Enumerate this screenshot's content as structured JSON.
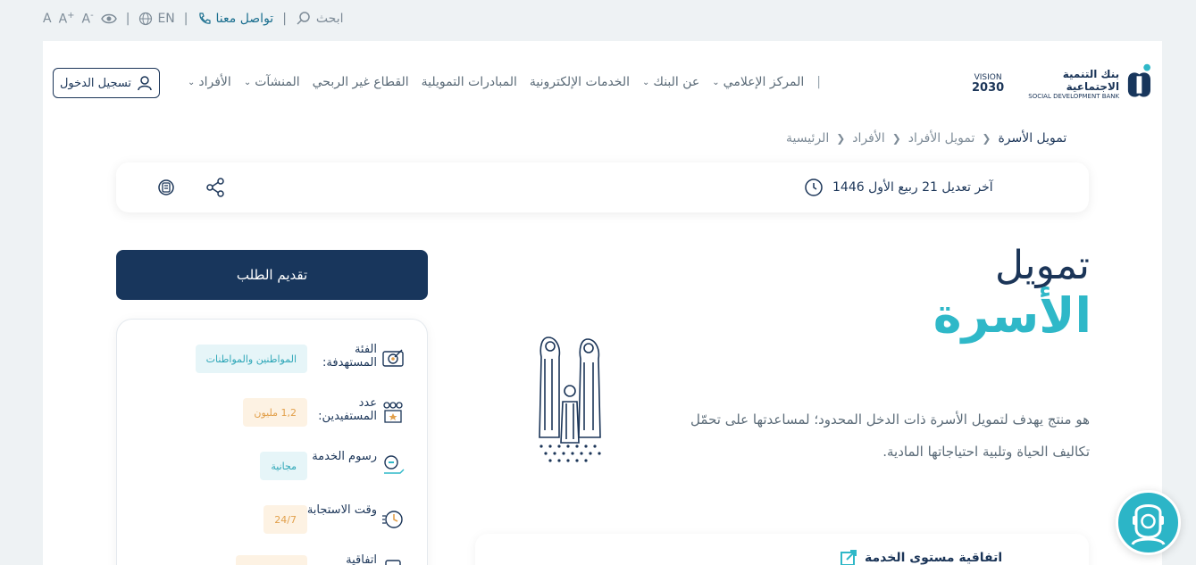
{
  "topbar": {
    "search": "ابحث",
    "contact": "تواصل معنا",
    "lang": "EN",
    "font_small": "A",
    "font_large": "A",
    "font_reset": "A",
    "minus": "-",
    "plus": "+",
    "sep": "|"
  },
  "logo": {
    "arabic": "بنك التنمية الاجتماعية",
    "english": "SOCIAL DEVELOPMENT BANK",
    "vision_label": "VISION",
    "vision_year": "2030"
  },
  "nav": {
    "items": [
      {
        "label": "الأفراد",
        "has_menu": true
      },
      {
        "label": "المنشآت",
        "has_menu": true
      },
      {
        "label": "القطاع غير الربحي",
        "has_menu": false
      },
      {
        "label": "المبادرات التمويلية",
        "has_menu": false
      },
      {
        "label": "الخدمات الإلكترونية",
        "has_menu": false
      },
      {
        "label": "عن البنك",
        "has_menu": true
      },
      {
        "label": "المركز الإعلامي",
        "has_menu": true
      }
    ],
    "divider": "|",
    "login": "تسجيل الدخول"
  },
  "breadcrumb": [
    "الرئيسية",
    "الأفراد",
    "تمويل الأفراد",
    "تمويل الأسرة"
  ],
  "modified": "آخر تعديل 21 ربيع الأول 1446",
  "title": {
    "line1": "تمويل",
    "line2": "الأسرة"
  },
  "description": "هو منتج يهدف لتمويل الأسرة ذات الدخل المحدود؛ لمساعدتها على تحمّل تكاليف الحياة وتلبية احتياجاتها المادية.",
  "apply_button": "تقديم الطلب",
  "info": [
    {
      "label": "الفئة المستهدفة:",
      "value": "المواطنين والمواطنات",
      "tone": "blue",
      "icon": "target-icon"
    },
    {
      "label": "عدد المستفيدين:",
      "value": "1,2 مليون",
      "tone": "orange",
      "icon": "people-icon"
    },
    {
      "label": "رسوم الخدمة",
      "value": "مجانية",
      "tone": "blue",
      "icon": "fee-icon"
    },
    {
      "label": "وقت الاستجابة:",
      "value": "24/7",
      "tone": "orange",
      "icon": "clock-icon"
    },
    {
      "label": "اتفاقية",
      "value": "",
      "tone": "orange",
      "icon": "agreement-icon"
    }
  ],
  "sla": "اتفاقية مستوى الخدمة",
  "colors": {
    "primary": "#18365c",
    "accent": "#2fb8c8",
    "orange": "#e2a04b"
  }
}
